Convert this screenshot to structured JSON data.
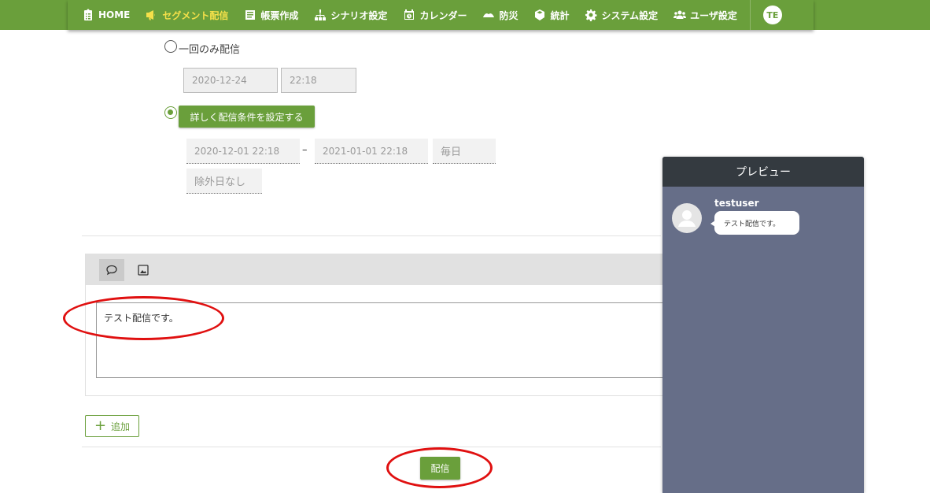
{
  "nav": {
    "items": [
      {
        "label": "HOME",
        "icon": "clipboard-list-icon"
      },
      {
        "label": "セグメント配信",
        "icon": "megaphone-icon"
      },
      {
        "label": "帳票作成",
        "icon": "document-list-icon"
      },
      {
        "label": "シナリオ設定",
        "icon": "sitemap-icon"
      },
      {
        "label": "カレンダー",
        "icon": "calendar-clock-icon"
      },
      {
        "label": "防災",
        "icon": "hands-icon"
      },
      {
        "label": "統計",
        "icon": "cube-icon"
      },
      {
        "label": "システム設定",
        "icon": "gear-icon"
      },
      {
        "label": "ユーザ設定",
        "icon": "users-icon"
      }
    ],
    "active_index": 1,
    "avatar": "TE"
  },
  "schedule": {
    "once_label": "一回のみ配信",
    "once_date": "2020-12-24",
    "once_time": "22:18",
    "detail_button": "詳しく配信条件を設定する",
    "start": "2020-12-01 22:18",
    "separator": "–",
    "end": "2021-01-01 22:18",
    "frequency": "毎日",
    "exclusion": "除外日なし"
  },
  "editor": {
    "message": "テスト配信です。"
  },
  "add_label": "追加",
  "send_label": "配信",
  "preview": {
    "title": "プレビュー",
    "username": "testuser",
    "message": "テスト配信です。"
  },
  "colors": {
    "brand_green": "#6a9f3b",
    "active_nav": "#f5e04a",
    "preview_bg": "#666e88",
    "preview_header": "#343a40",
    "annotation_red": "#e01010"
  }
}
